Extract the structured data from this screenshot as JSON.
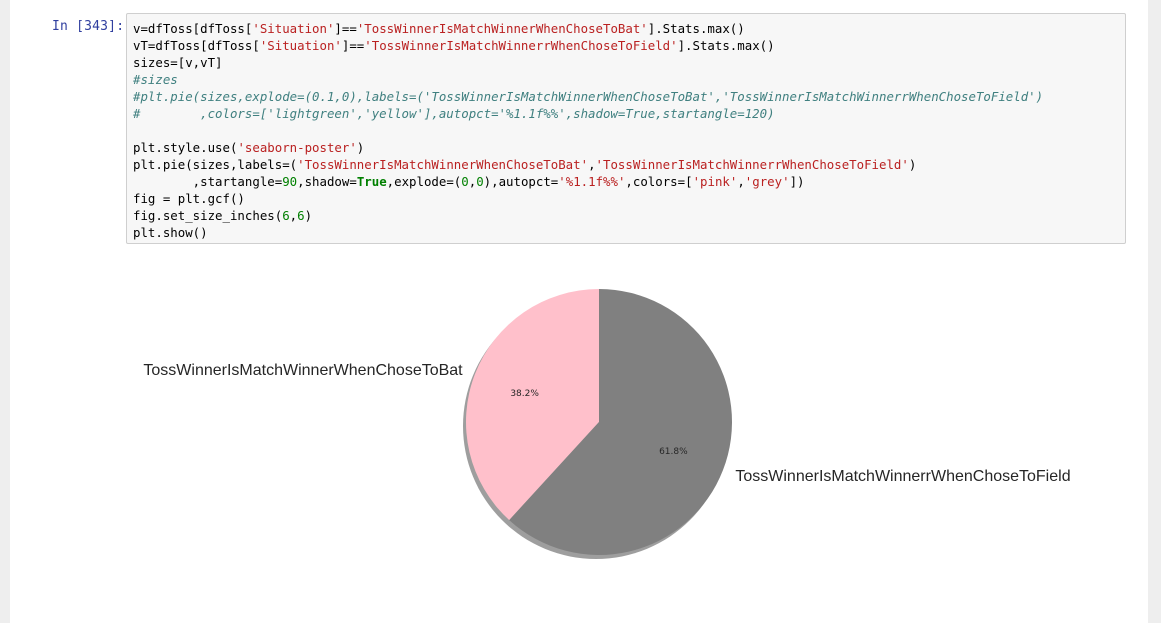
{
  "cell": {
    "prompt": "In [343]:",
    "code_lines": [
      [
        {
          "t": "pl",
          "v": "v=dfToss[dfToss["
        },
        {
          "t": "str",
          "v": "'Situation'"
        },
        {
          "t": "pl",
          "v": "]=="
        },
        {
          "t": "str",
          "v": "'TossWinnerIsMatchWinnerWhenChoseToBat'"
        },
        {
          "t": "pl",
          "v": "].Stats.max()"
        }
      ],
      [
        {
          "t": "pl",
          "v": "vT=dfToss[dfToss["
        },
        {
          "t": "str",
          "v": "'Situation'"
        },
        {
          "t": "pl",
          "v": "]=="
        },
        {
          "t": "str",
          "v": "'TossWinnerIsMatchWinnerrWhenChoseToField'"
        },
        {
          "t": "pl",
          "v": "].Stats.max()"
        }
      ],
      [
        {
          "t": "pl",
          "v": "sizes=[v,vT]"
        }
      ],
      [
        {
          "t": "com",
          "v": "#sizes"
        }
      ],
      [
        {
          "t": "com",
          "v": "#plt.pie(sizes,explode=(0.1,0),labels=('TossWinnerIsMatchWinnerWhenChoseToBat','TossWinnerIsMatchWinnerrWhenChoseToField')"
        }
      ],
      [
        {
          "t": "com",
          "v": "#        ,colors=['lightgreen','yellow'],autopct='%1.1f%%',shadow=True,startangle=120)"
        }
      ],
      [
        {
          "t": "pl",
          "v": " "
        }
      ],
      [
        {
          "t": "pl",
          "v": "plt.style.use("
        },
        {
          "t": "str",
          "v": "'seaborn-poster'"
        },
        {
          "t": "pl",
          "v": ")"
        }
      ],
      [
        {
          "t": "pl",
          "v": "plt.pie(sizes,labels=("
        },
        {
          "t": "str",
          "v": "'TossWinnerIsMatchWinnerWhenChoseToBat'"
        },
        {
          "t": "pl",
          "v": ","
        },
        {
          "t": "str",
          "v": "'TossWinnerIsMatchWinnerrWhenChoseToField'"
        },
        {
          "t": "pl",
          "v": ")"
        }
      ],
      [
        {
          "t": "pl",
          "v": "        ,startangle="
        },
        {
          "t": "num",
          "v": "90"
        },
        {
          "t": "pl",
          "v": ",shadow="
        },
        {
          "t": "kw",
          "v": "True"
        },
        {
          "t": "pl",
          "v": ",explode=("
        },
        {
          "t": "num",
          "v": "0"
        },
        {
          "t": "pl",
          "v": ","
        },
        {
          "t": "num",
          "v": "0"
        },
        {
          "t": "pl",
          "v": "),autopct="
        },
        {
          "t": "str",
          "v": "'%1.1f%%'"
        },
        {
          "t": "pl",
          "v": ",colors=["
        },
        {
          "t": "str",
          "v": "'pink'"
        },
        {
          "t": "pl",
          "v": ","
        },
        {
          "t": "str",
          "v": "'grey'"
        },
        {
          "t": "pl",
          "v": "])"
        }
      ],
      [
        {
          "t": "pl",
          "v": "fig = plt.gcf()"
        }
      ],
      [
        {
          "t": "pl",
          "v": "fig.set_size_inches("
        },
        {
          "t": "num",
          "v": "6"
        },
        {
          "t": "pl",
          "v": ","
        },
        {
          "t": "num",
          "v": "6"
        },
        {
          "t": "pl",
          "v": ")"
        }
      ],
      [
        {
          "t": "pl",
          "v": "plt.show()"
        }
      ]
    ]
  },
  "chart_data": {
    "type": "pie",
    "categories": [
      "TossWinnerIsMatchWinnerWhenChoseToBat",
      "TossWinnerIsMatchWinnerrWhenChoseToField"
    ],
    "values": [
      38.2,
      61.8
    ],
    "pct_labels": [
      "38.2%",
      "61.8%"
    ],
    "colors": [
      "#ffc0cb",
      "#808080"
    ],
    "startangle": 90,
    "shadow": true,
    "title": "",
    "legend": "none"
  }
}
